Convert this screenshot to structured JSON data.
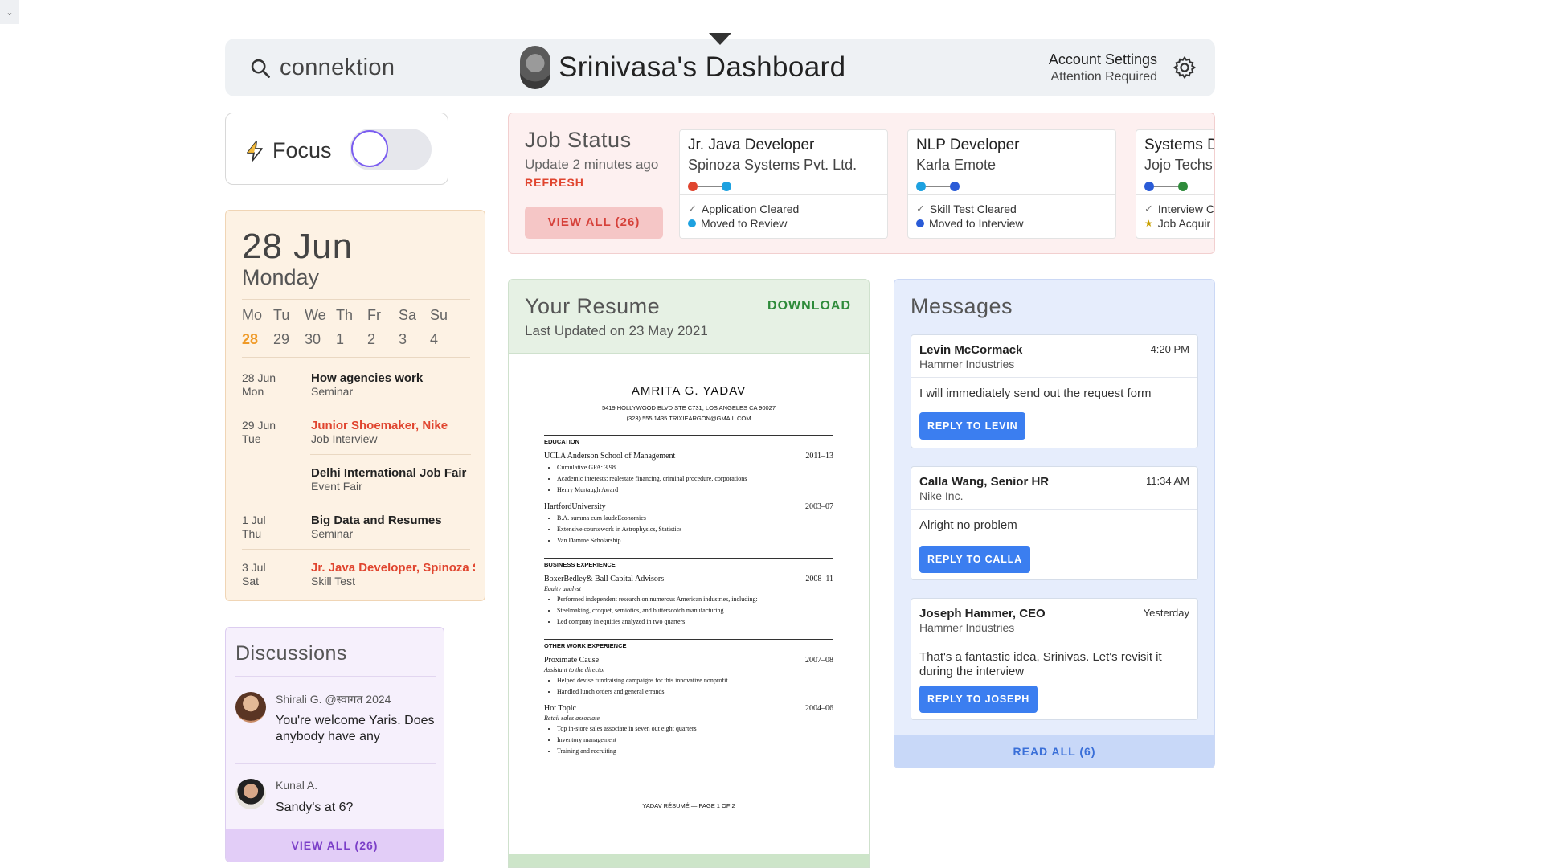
{
  "header": {
    "search_text": "connektion",
    "title": "Srinivasa's Dashboard",
    "account_title": "Account Settings",
    "account_status": "Attention Required"
  },
  "focus": {
    "label": "Focus",
    "enabled": false,
    "accent": "#7a5cf0"
  },
  "calendar": {
    "date": "28 Jun",
    "weekday": "Monday",
    "day_headers": [
      "Mo",
      "Tu",
      "We",
      "Th",
      "Fr",
      "Sa",
      "Su"
    ],
    "day_numbers": [
      "28",
      "29",
      "30",
      "1",
      "2",
      "3",
      "4"
    ],
    "events": [
      {
        "date": "28 Jun",
        "day": "Mon",
        "title": "How agencies work",
        "type": "Seminar",
        "highlight": false
      },
      {
        "date": "29 Jun",
        "day": "Tue",
        "title": "Junior Shoemaker, Nike",
        "type": "Job Interview",
        "highlight": true
      },
      {
        "date": "",
        "day": "",
        "title": "Delhi International Job Fair",
        "type": "Event Fair",
        "highlight": false
      },
      {
        "date": "1 Jul",
        "day": "Thu",
        "title": "Big Data and Resumes",
        "type": "Seminar",
        "highlight": false
      },
      {
        "date": "3 Jul",
        "day": "Sat",
        "title": "Jr. Java Developer, Spinoza S",
        "type": "Skill Test",
        "highlight": true
      }
    ]
  },
  "discussions": {
    "title": "Discussions",
    "items": [
      {
        "name": "Shirali G. @स्वागत 2024",
        "message": "You're welcome Yaris. Does anybody have any"
      },
      {
        "name": "Kunal A.",
        "message": "Sandy's at 6?"
      }
    ],
    "view_all": "VIEW ALL (26)"
  },
  "job_status": {
    "title": "Job Status",
    "updated": "Update 2 minutes ago",
    "refresh": "REFRESH",
    "view_all": "VIEW ALL (26)",
    "jobs": [
      {
        "title": "Jr. Java Developer",
        "company": "Spinoza Systems Pvt. Ltd.",
        "status1": "Application Cleared",
        "status2": "Moved to Review",
        "dots": [
          "#e0452f",
          "#1da1e0"
        ]
      },
      {
        "title": "NLP Developer",
        "company": "Karla Emote",
        "status1": "Skill Test Cleared",
        "status2": "Moved to Interview",
        "dots": [
          "#1da1e0",
          "#2a5bd7"
        ]
      },
      {
        "title": "Systems D",
        "company": "Jojo Techs",
        "status1": "Interview C",
        "status2": "Job Acquir",
        "dots": [
          "#2a5bd7",
          "#2e8b3a"
        ]
      }
    ]
  },
  "resume": {
    "title": "Your Resume",
    "updated": "Last Updated on 23 May 2021",
    "download": "DOWNLOAD",
    "doc": {
      "name": "AMRITA G. YADAV",
      "address": "5419 HOLLYWOOD BLVD  STE C731, LOS ANGELES CA 90027",
      "contact": "(323) 555 1435   TRIXIEARGON@GMAIL.COM",
      "sec_education": "EDUCATION",
      "edu1_school": "UCLA  Anderson School of Management",
      "edu1_years": "2011–13",
      "edu1_b1": "Cumulative GPA: 3.98",
      "edu1_b2": "Academic interests: realestate financing, criminal procedure, corporations",
      "edu1_b3": "Henry Murtaugh Award",
      "edu2_school": "HartfordUniversity",
      "edu2_years": "2003–07",
      "edu2_b1": "B.A. summa cum laudeEconomics",
      "edu2_b2": "Extensive coursework in Astrophysics, Statistics",
      "edu2_b3": "Van Damme Scholarship",
      "sec_business": "BUSINESS EXPERIENCE",
      "job1_org": "BoxerBedley& Ball Capital Advisors",
      "job1_years": "2008–11",
      "job1_role": "Equity analyst",
      "job1_b1": "Performed independent research on numerous American industries, including:",
      "job1_b2": "Steelmaking, croquet, semiotics, and butterscotch manufacturing",
      "job1_b3": "Led company in equities analyzed in two quarters",
      "sec_other": "OTHER WORK EXPERIENCE",
      "job2_org": "Proximate Cause",
      "job2_years": "2007–08",
      "job2_role": "Assistant to the director",
      "job2_b1": "Helped devise fundraising campaigns for this innovative nonprofit",
      "job2_b2": "Handled lunch orders and general errands",
      "job3_org": "Hot Topic",
      "job3_years": "2004–06",
      "job3_role": "Retail sales associate",
      "job3_b1": "Top in-store sales associate in seven out eight quarters",
      "job3_b2": "Inventory management",
      "job3_b3": "Training and recruiting",
      "footer": "YADAV RÉSUMÉ  —  PAGE 1 OF 2"
    }
  },
  "messages": {
    "title": "Messages",
    "items": [
      {
        "from": "Levin McCormack",
        "org": "Hammer Industries",
        "time": "4:20 PM",
        "body": "I will immediately send out the request form",
        "reply": "REPLY TO LEVIN"
      },
      {
        "from": "Calla Wang, Senior HR",
        "org": "Nike Inc.",
        "time": "11:34 AM",
        "body": "Alright no problem",
        "reply": "REPLY TO CALLA"
      },
      {
        "from": "Joseph Hammer, CEO",
        "org": "Hammer Industries",
        "time": "Yesterday",
        "body": "That's a fantastic idea, Srinivas.  Let's revisit it during the interview",
        "reply": "REPLY TO JOSEPH"
      }
    ],
    "read_all": "READ ALL (6)"
  },
  "icons": {
    "corner": "chevron-down-icon",
    "search": "search-icon",
    "gear": "gear-icon",
    "focus": "lightning-icon",
    "dropdown": "caret-down-icon"
  }
}
